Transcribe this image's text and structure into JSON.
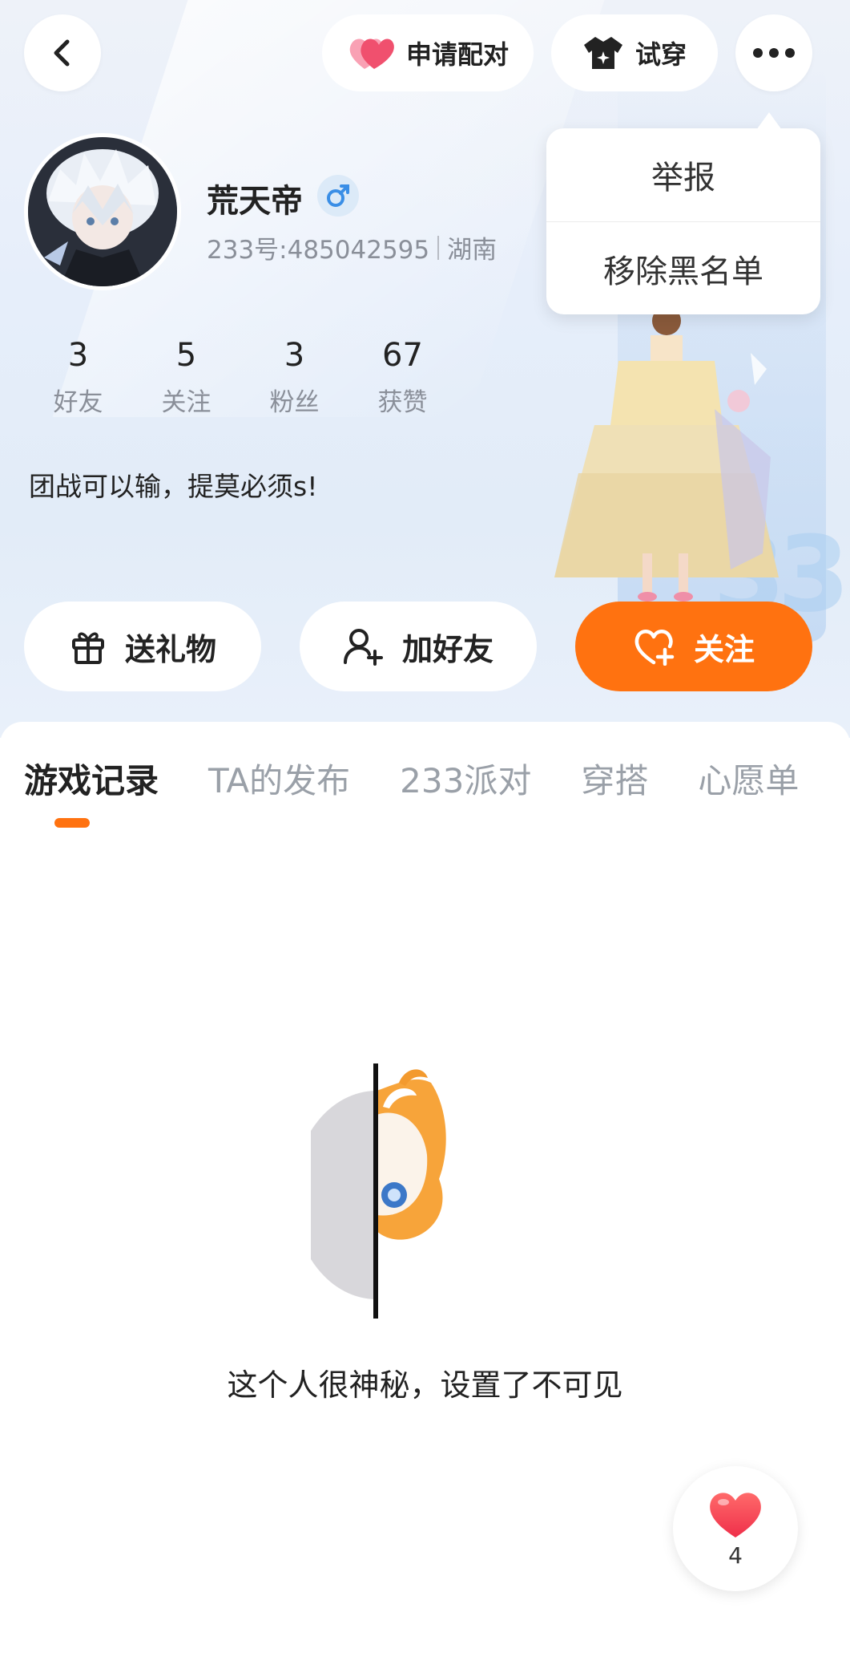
{
  "topbar": {
    "match_label": "申请配对",
    "tryon_label": "试穿"
  },
  "menu": {
    "items": [
      "举报",
      "移除黑名单"
    ]
  },
  "profile": {
    "name": "荒天帝",
    "uid": "233号:485042595",
    "location": "湖南",
    "bio": "团战可以输，提莫必须s!",
    "stats": [
      {
        "value": "3",
        "label": "好友"
      },
      {
        "value": "5",
        "label": "关注"
      },
      {
        "value": "3",
        "label": "粉丝"
      },
      {
        "value": "67",
        "label": "获赞"
      }
    ]
  },
  "actions": {
    "gift": "送礼物",
    "add_friend": "加好友",
    "follow": "关注"
  },
  "tabs": [
    "游戏记录",
    "TA的发布",
    "233派对",
    "穿搭",
    "心愿单"
  ],
  "empty_state": {
    "text": "这个人很神秘，设置了不可见"
  },
  "like_fab": {
    "count": "4"
  },
  "colors": {
    "accent": "#ff7210",
    "heart": "#f0506e",
    "gender_male": "#3a8ee6"
  }
}
